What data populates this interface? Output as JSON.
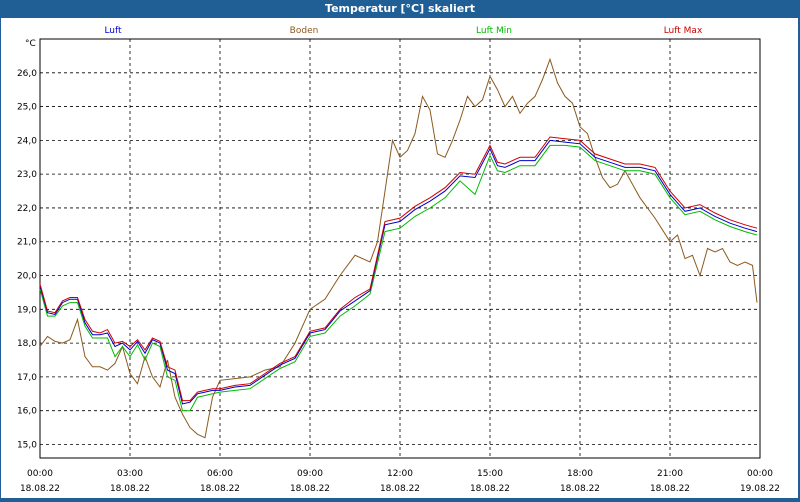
{
  "window": {
    "title": "Temperatur [°C] skaliert"
  },
  "chart_data": {
    "type": "line",
    "ylabel": "°C",
    "ylim": [
      14.6,
      27.0
    ],
    "yticks": [
      "15,0",
      "16,0",
      "17,0",
      "18,0",
      "19,0",
      "20,0",
      "21,0",
      "22,0",
      "23,0",
      "24,0",
      "25,0",
      "26,0"
    ],
    "xlim": [
      0,
      24
    ],
    "xticks": [
      {
        "time": "00:00",
        "date": "18.08.22"
      },
      {
        "time": "03:00",
        "date": "18.08.22"
      },
      {
        "time": "06:00",
        "date": "18.08.22"
      },
      {
        "time": "09:00",
        "date": "18.08.22"
      },
      {
        "time": "12:00",
        "date": "18.08.22"
      },
      {
        "time": "15:00",
        "date": "18.08.22"
      },
      {
        "time": "18:00",
        "date": "18.08.22"
      },
      {
        "time": "21:00",
        "date": "18.08.22"
      },
      {
        "time": "00:00",
        "date": "19.08.22"
      }
    ],
    "grid": true,
    "legend": "top",
    "series": [
      {
        "name": "Luft",
        "color": "#0000cc",
        "x": [
          0,
          0.25,
          0.5,
          0.75,
          1,
          1.25,
          1.5,
          1.75,
          2,
          2.25,
          2.5,
          2.75,
          3,
          3.25,
          3.5,
          3.75,
          4,
          4.25,
          4.5,
          4.75,
          5,
          5.25,
          5.5,
          5.75,
          6,
          6.5,
          7,
          7.5,
          8,
          8.5,
          9,
          9.5,
          10,
          10.5,
          11,
          11.5,
          12,
          12.5,
          13,
          13.5,
          14,
          14.5,
          15,
          15.25,
          15.5,
          15.75,
          16,
          16.5,
          17,
          17.5,
          18,
          18.5,
          19,
          19.5,
          20,
          20.5,
          21,
          21.5,
          22,
          22.5,
          23,
          23.5,
          23.9
        ],
        "y": [
          19.7,
          18.9,
          18.85,
          19.2,
          19.3,
          19.3,
          18.6,
          18.25,
          18.25,
          18.3,
          17.9,
          18.0,
          17.8,
          18.05,
          17.7,
          18.1,
          18.0,
          17.2,
          17.1,
          16.2,
          16.25,
          16.5,
          16.55,
          16.6,
          16.6,
          16.7,
          16.75,
          17.05,
          17.35,
          17.55,
          18.3,
          18.4,
          18.95,
          19.25,
          19.55,
          21.5,
          21.6,
          21.95,
          22.2,
          22.5,
          22.95,
          22.9,
          23.75,
          23.25,
          23.2,
          23.3,
          23.4,
          23.4,
          24.0,
          23.95,
          23.9,
          23.5,
          23.35,
          23.2,
          23.2,
          23.1,
          22.4,
          21.9,
          22.0,
          21.75,
          21.55,
          21.4,
          21.3
        ]
      },
      {
        "name": "Boden",
        "color": "#8b5a1e",
        "x": [
          0,
          0.25,
          0.5,
          0.75,
          1,
          1.25,
          1.5,
          1.75,
          2,
          2.25,
          2.5,
          2.75,
          3,
          3.25,
          3.5,
          3.75,
          4,
          4.25,
          4.5,
          4.75,
          5,
          5.25,
          5.5,
          5.75,
          6,
          6.5,
          7,
          7.5,
          8,
          8.5,
          9,
          9.5,
          10,
          10.5,
          11,
          11.25,
          11.5,
          11.75,
          12,
          12.25,
          12.5,
          12.75,
          13,
          13.25,
          13.5,
          13.75,
          14,
          14.25,
          14.5,
          14.75,
          15,
          15.25,
          15.5,
          15.75,
          16,
          16.25,
          16.5,
          16.75,
          17,
          17.25,
          17.5,
          17.75,
          18,
          18.25,
          18.5,
          18.75,
          19,
          19.25,
          19.5,
          20,
          20.5,
          21,
          21.25,
          21.5,
          21.75,
          22,
          22.25,
          22.5,
          22.75,
          23,
          23.25,
          23.5,
          23.75,
          23.9
        ],
        "y": [
          17.9,
          18.2,
          18.05,
          18.0,
          18.1,
          18.7,
          17.6,
          17.3,
          17.3,
          17.2,
          17.4,
          17.9,
          17.1,
          16.8,
          17.6,
          17.0,
          16.7,
          17.5,
          16.4,
          15.9,
          15.5,
          15.3,
          15.2,
          16.4,
          16.9,
          16.95,
          17.0,
          17.2,
          17.3,
          18.0,
          19.0,
          19.3,
          20.0,
          20.6,
          20.4,
          21.0,
          22.5,
          24.0,
          23.5,
          23.7,
          24.2,
          25.3,
          24.9,
          23.6,
          23.5,
          24.0,
          24.6,
          25.3,
          25.0,
          25.2,
          25.9,
          25.5,
          25.0,
          25.3,
          24.8,
          25.1,
          25.3,
          25.8,
          26.4,
          25.7,
          25.3,
          25.1,
          24.4,
          24.2,
          23.5,
          22.9,
          22.6,
          22.7,
          23.1,
          22.3,
          21.7,
          21.0,
          21.2,
          20.5,
          20.6,
          20.0,
          20.8,
          20.7,
          20.8,
          20.4,
          20.3,
          20.4,
          20.3,
          19.2
        ]
      },
      {
        "name": "Luft Min",
        "color": "#00bb00",
        "x": [
          0,
          0.25,
          0.5,
          0.75,
          1,
          1.25,
          1.5,
          1.75,
          2,
          2.25,
          2.5,
          2.75,
          3,
          3.25,
          3.5,
          3.75,
          4,
          4.25,
          4.5,
          4.75,
          5,
          5.25,
          5.5,
          5.75,
          6,
          6.5,
          7,
          7.5,
          8,
          8.5,
          9,
          9.5,
          10,
          10.5,
          11,
          11.5,
          12,
          12.5,
          13,
          13.5,
          14,
          14.5,
          15,
          15.25,
          15.5,
          15.75,
          16,
          16.5,
          17,
          17.5,
          18,
          18.5,
          19,
          19.5,
          20,
          20.5,
          21,
          21.5,
          22,
          22.5,
          23,
          23.5,
          23.9
        ],
        "y": [
          19.6,
          18.8,
          18.8,
          19.1,
          19.2,
          19.2,
          18.5,
          18.15,
          18.15,
          18.15,
          17.6,
          17.9,
          17.6,
          17.95,
          17.5,
          18.0,
          17.9,
          17.0,
          16.9,
          16.0,
          16.0,
          16.4,
          16.45,
          16.5,
          16.55,
          16.6,
          16.65,
          16.95,
          17.25,
          17.45,
          18.2,
          18.3,
          18.8,
          19.1,
          19.45,
          21.3,
          21.4,
          21.75,
          22.0,
          22.3,
          22.8,
          22.4,
          23.55,
          23.1,
          23.05,
          23.15,
          23.25,
          23.25,
          23.85,
          23.85,
          23.8,
          23.4,
          23.25,
          23.1,
          23.1,
          23.0,
          22.3,
          21.8,
          21.9,
          21.65,
          21.45,
          21.3,
          21.2
        ]
      },
      {
        "name": "Luft Max",
        "color": "#cc0000",
        "x": [
          0,
          0.25,
          0.5,
          0.75,
          1,
          1.25,
          1.5,
          1.75,
          2,
          2.25,
          2.5,
          2.75,
          3,
          3.25,
          3.5,
          3.75,
          4,
          4.25,
          4.5,
          4.75,
          5,
          5.25,
          5.5,
          5.75,
          6,
          6.5,
          7,
          7.5,
          8,
          8.5,
          9,
          9.5,
          10,
          10.5,
          11,
          11.5,
          12,
          12.5,
          13,
          13.5,
          14,
          14.5,
          15,
          15.25,
          15.5,
          15.75,
          16,
          16.5,
          17,
          17.5,
          18,
          18.5,
          19,
          19.5,
          20,
          20.5,
          21,
          21.5,
          22,
          22.5,
          23,
          23.5,
          23.9
        ],
        "y": [
          19.75,
          18.95,
          18.9,
          19.25,
          19.35,
          19.35,
          18.7,
          18.35,
          18.3,
          18.4,
          18.0,
          18.05,
          17.9,
          18.1,
          17.8,
          18.15,
          18.05,
          17.3,
          17.2,
          16.3,
          16.3,
          16.55,
          16.6,
          16.65,
          16.65,
          16.75,
          16.8,
          17.1,
          17.4,
          17.6,
          18.35,
          18.45,
          19.0,
          19.35,
          19.6,
          21.6,
          21.7,
          22.05,
          22.3,
          22.6,
          23.05,
          23.0,
          23.85,
          23.35,
          23.3,
          23.4,
          23.5,
          23.5,
          24.1,
          24.05,
          24.0,
          23.6,
          23.45,
          23.3,
          23.3,
          23.2,
          22.5,
          22.0,
          22.1,
          21.85,
          21.65,
          21.5,
          21.4
        ]
      }
    ]
  }
}
